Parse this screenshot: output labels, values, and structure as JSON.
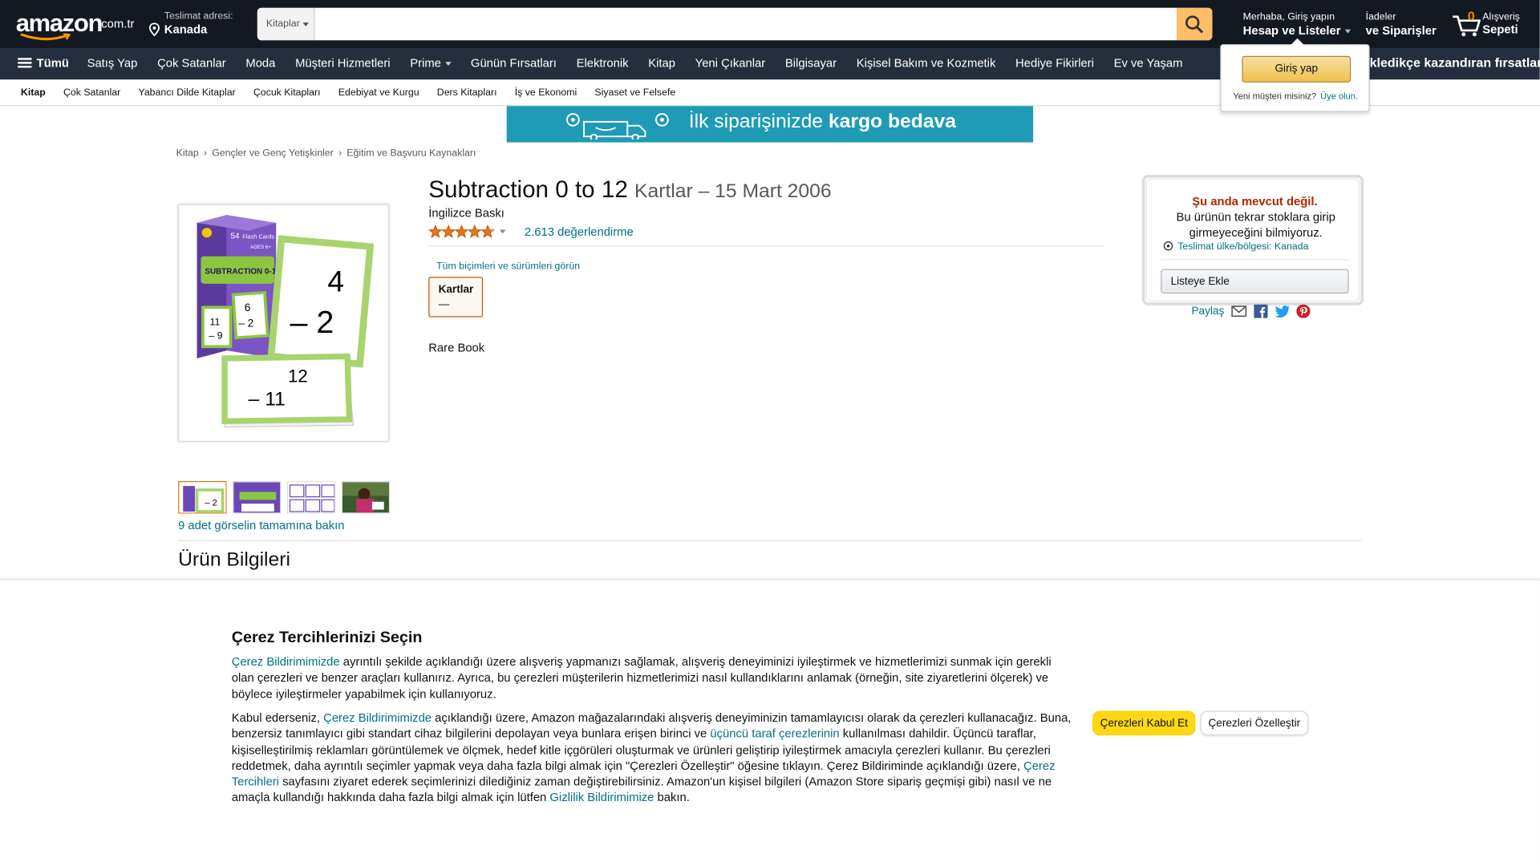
{
  "header": {
    "logo_word": "amazon",
    "logo_tld": ".com.tr",
    "deliver_line1": "Teslimat adresi:",
    "deliver_line2": "Kanada",
    "search_category": "Kitaplar",
    "search_placeholder": "",
    "account_line1": "Merhaba, Giriş yapın",
    "account_line2": "Hesap ve Listeler",
    "orders_line1": "İadeler",
    "orders_line2": "ve Siparişler",
    "cart_count": "0",
    "cart_line1": "Alışveriş",
    "cart_line2": "Sepeti"
  },
  "nav": {
    "all": "Tümü",
    "items": [
      "Satış Yap",
      "Çok Satanlar",
      "Moda",
      "Müşteri Hizmetleri",
      "Prime",
      "Günün Fırsatları",
      "Elektronik",
      "Kitap",
      "Yeni Çıkanlar",
      "Bilgisayar",
      "Kişisel Bakım ve Kozmetik",
      "Hediye Fikirleri",
      "Ev ve Yaşam"
    ],
    "promo": "keşfettikçe kazandıran fırsatlar",
    "promo_visible": "kledikçe kazandıran fırsatlar"
  },
  "subnav": [
    "Kitap",
    "Çok Satanlar",
    "Yabancı Dilde Kitaplar",
    "Çocuk Kitapları",
    "Edebiyat ve Kurgu",
    "Ders Kitapları",
    "İş ve Ekonomi",
    "Siyaset ve Felsefe"
  ],
  "banner": {
    "text_prefix": "İlk siparişinizde",
    "text_bold": "kargo bedava"
  },
  "flyout": {
    "signin": "Giriş yap",
    "new_customer": "Yeni müşteri misiniz?",
    "register": "Üye olun."
  },
  "breadcrumb": [
    "Kitap",
    "Gençler ve Genç Yetişkinler",
    "Eğitim ve Başvuru Kaynakları"
  ],
  "product": {
    "title": "Subtraction 0 to 12",
    "format_date": "Kartlar – 15 Mart 2006",
    "edition": "İngilizce Baskı",
    "rating": 4.8,
    "rating_count": "2.613 değerlendirme",
    "all_formats": "Tüm biçimleri ve sürümleri görün",
    "format_name": "Kartlar",
    "format_price": "—",
    "rare": "Rare Book",
    "see_all_images": "9 adet görselin tamamına bakın",
    "image_box_count": "54",
    "image_box_label": "Flash Cards",
    "image_box_title": "SUBTRACTION 0-12",
    "image_age": "AGES 6+"
  },
  "buybox": {
    "unavailable": "Şu anda mevcut değil.",
    "description": "Bu ürünün tekrar stoklara girip girmeyeceğini bilmiyoruz.",
    "delivery_location": "Teslimat ülke/bölgesi: Kanada",
    "add_to_list": "Listeye Ekle",
    "share": "Paylaş"
  },
  "section": {
    "product_info": "Ürün Bilgileri"
  },
  "cookie": {
    "title": "Çerez Tercihlerinizi Seçin",
    "p1_link": "Çerez Bildirimimizde",
    "p1_text": " ayrıntılı şekilde açıklandığı üzere alışveriş yapmanızı sağlamak, alışveriş deneyiminizi iyileştirmek ve hizmetlerimizi sunmak için gerekli olan çerezleri ve benzer araçları kullanırız. Ayrıca, bu çerezleri müşterilerin hizmetlerimizi nasıl kullandıklarını anlamak (örneğin, site ziyaretlerini ölçerek) ve böylece iyileştirmeler yapabilmek için kullanıyoruz.",
    "p2_a": "Kabul ederseniz, ",
    "p2_link1": "Çerez Bildirimimizde",
    "p2_b": " açıklandığı üzere, Amazon mağazalarındaki alışveriş deneyiminizin tamamlayıcısı olarak da çerezleri kullanacağız. Buna, benzersiz tanımlayıcı gibi standart cihaz bilgilerini depolayan veya bunlara erişen birinci ve ",
    "p2_link2": "üçüncü taraf çerezlerinin",
    "p2_c": " kullanılması dahildir. Üçüncü taraflar, kişiselleştirilmiş reklamları görüntülemek ve ölçmek, hedef kitle içgörüleri oluşturmak ve ürünleri geliştirip iyileştirmek amacıyla çerezleri kullanır. Bu çerezleri reddetmek, daha ayrıntılı seçimler yapmak veya daha fazla bilgi almak için \"Çerezleri Özelleştir\" öğesine tıklayın. Çerez Bildiriminde açıklandığı üzere, ",
    "p2_link3": "Çerez Tercihleri",
    "p2_d": " sayfasını ziyaret ederek seçimlerinizi dilediğiniz zaman değiştirebilirsiniz. Amazon'un kişisel bilgileri (Amazon Store sipariş geçmişi gibi) nasıl ve ne amaçla kullandığı hakkında daha fazla bilgi almak için lütfen ",
    "p2_link4": "Gizlilik Bildirimimize",
    "p2_e": " bakın.",
    "accept": "Çerezleri Kabul Et",
    "customize": "Çerezleri Özelleştir"
  },
  "colors": {
    "header_bg": "#131921",
    "nav_bg": "#232f3e",
    "search_button": "#febd69",
    "link": "#007185",
    "unavailable": "#B12704",
    "accept_button": "#ffd814",
    "star": "#de7921",
    "banner": "#1f9bb5"
  },
  "icons": [
    "search-icon",
    "location-pin-icon",
    "cart-icon",
    "hamburger-icon",
    "truck-icon",
    "star-icon",
    "mail-icon",
    "facebook-icon",
    "twitter-icon",
    "pinterest-icon"
  ]
}
